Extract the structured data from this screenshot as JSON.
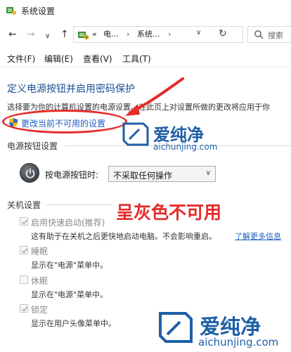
{
  "window": {
    "title": "系统设置"
  },
  "address": {
    "crumbs": [
      "«",
      "电...",
      "系统..."
    ],
    "search_placeholder": "搜索"
  },
  "menu": [
    "文件(F)",
    "编辑(E)",
    "查看(V)",
    "工具(T)"
  ],
  "content": {
    "title": "定义电源按钮并启用密码保护",
    "intro": "选择要为你的计算机设置的电源设置。在此页上对设置所做的更改将应用于你",
    "change_link": "更改当前不可用的设置"
  },
  "power_section": {
    "heading": "电源按钮设置",
    "label": "按电源按钮时:",
    "selected": "不采取任何操作"
  },
  "shutdown_section": {
    "heading": "关机设置",
    "options": [
      {
        "label": "启用快速启动(推荐)",
        "desc": "这有助于在关机之后更快地启动电脑。不会影响重启。",
        "link": "了解更多信息",
        "checked": true
      },
      {
        "label": "睡眠",
        "desc": "显示在\"电源\"菜单中。",
        "checked": true
      },
      {
        "label": "休眠",
        "desc": "显示在\"电源\"菜单中。",
        "checked": false
      },
      {
        "label": "锁定",
        "desc": "显示在用户头像菜单中。",
        "checked": true
      }
    ]
  },
  "annotation": "呈灰色不可用",
  "watermark": {
    "brand": "爱纯净",
    "url": "aichunjing.com"
  },
  "colors": {
    "link": "#1f5fbf",
    "annotation": "#e52b2b",
    "title": "#1a4f95",
    "watermark": "#1e5fa8"
  }
}
